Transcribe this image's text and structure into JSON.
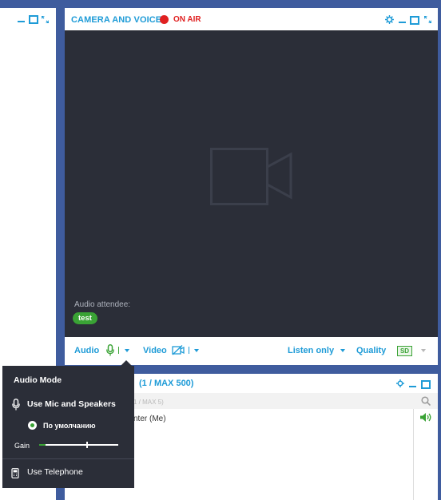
{
  "camera_panel": {
    "title": "CAMERA AND VOICE",
    "on_air": "ON AIR",
    "audio_attendee_label": "Audio attendee:",
    "attendee_chip": "test",
    "toolbar": {
      "audio": "Audio",
      "video": "Video",
      "listen_only": "Listen only",
      "quality": "Quality",
      "quality_value": "SD"
    }
  },
  "attendees_panel": {
    "title": "(1 / MAX 500)",
    "subtitle": "1 / MAX 5)",
    "list": [
      {
        "name": "nter (Me)"
      }
    ]
  },
  "audio_popup": {
    "title": "Audio Mode",
    "mic_option": "Use Mic and Speakers",
    "device_option": "По умолчанию",
    "gain_label": "Gain",
    "gain_level": 0.6,
    "telephone_option": "Use Telephone"
  },
  "colors": {
    "accent": "#1e9bd7",
    "on_air": "#e02020",
    "active_green": "#3aa335",
    "dark_bg": "#2b2e38",
    "page_bg": "#3f5c9e"
  },
  "icons": {
    "camera_placeholder": "video-camera-icon",
    "mic": "microphone-icon",
    "video_off": "video-off-icon",
    "settings": "gear-icon",
    "search": "search-icon",
    "speaker": "speaker-icon",
    "telephone": "telephone-icon"
  }
}
